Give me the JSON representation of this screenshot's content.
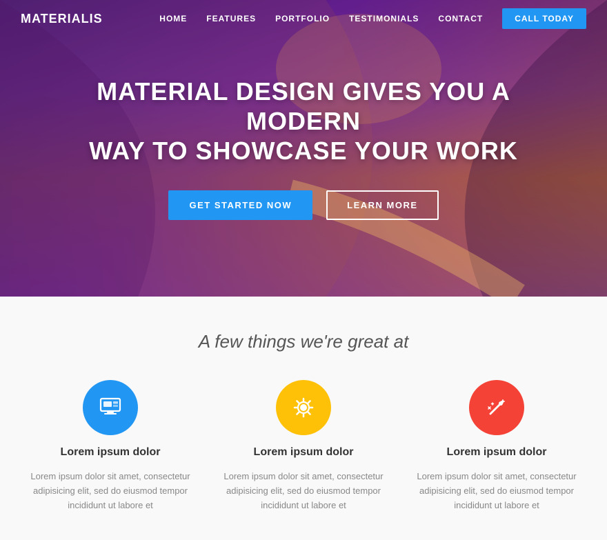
{
  "brand": "MATERIALIS",
  "nav": {
    "items": [
      {
        "label": "HOME",
        "id": "home"
      },
      {
        "label": "FEATURES",
        "id": "features"
      },
      {
        "label": "PORTFOLIO",
        "id": "portfolio"
      },
      {
        "label": "TESTIMONIALS",
        "id": "testimonials"
      },
      {
        "label": "CONTACT",
        "id": "contact"
      }
    ],
    "cta": "CALL TODAY"
  },
  "hero": {
    "title_line1": "MATERIAL DESIGN GIVES YOU A MODERN",
    "title_line2": "WAY TO SHOWCASE YOUR WORK",
    "btn_primary": "GET STARTED NOW",
    "btn_outline": "LEARN MORE"
  },
  "features": {
    "section_title": "A few things we're great at",
    "items": [
      {
        "icon": "monitor",
        "color": "#2196F3",
        "name": "Lorem ipsum dolor",
        "desc": "Lorem ipsum dolor sit amet, consectetur adipisicing elit, sed do eiusmod tempor incididunt ut labore et"
      },
      {
        "icon": "gear",
        "color": "#FFC107",
        "name": "Lorem ipsum dolor",
        "desc": "Lorem ipsum dolor sit amet, consectetur adipisicing elit, sed do eiusmod tempor incididunt ut labore et"
      },
      {
        "icon": "magic",
        "color": "#F44336",
        "name": "Lorem ipsum dolor",
        "desc": "Lorem ipsum dolor sit amet, consectetur adipisicing elit, sed do eiusmod tempor incididunt ut labore et"
      }
    ]
  }
}
